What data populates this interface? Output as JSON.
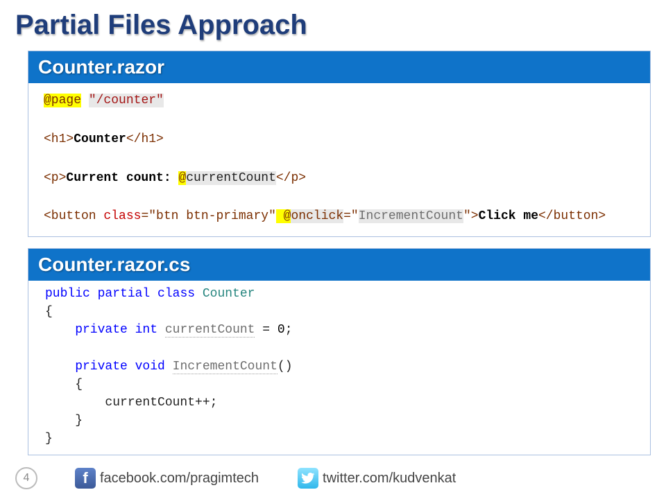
{
  "title": "Partial Files Approach",
  "card1": {
    "header": "Counter.razor",
    "code": {
      "page_directive": "@page",
      "route": "\"/counter\"",
      "h1_open": "<h1>",
      "h1_text": "Counter",
      "h1_close": "</h1>",
      "p_open": "<p>",
      "p_text": "Current count: ",
      "at_var": "@currentCount",
      "p_close": "</p>",
      "btn_open": "<button",
      "btn_class_attr": " class",
      "btn_class_val": "=\"btn btn-primary\"",
      "btn_onclick_at": " @onclick",
      "btn_onclick_val_eq": "=\"",
      "btn_onclick_handler": "IncrementCount",
      "btn_onclick_val_close": "\"",
      "btn_open_end": ">",
      "btn_text": "Click me",
      "btn_close": "</button>"
    }
  },
  "card2": {
    "header": "Counter.razor.cs",
    "code": {
      "l1a": "public",
      "l1b": " partial",
      "l1c": " class",
      "l1d": " Counter",
      "l2": "{",
      "l3a": "    private",
      "l3b": " int",
      "l3c": " ",
      "l3ident": "currentCount",
      "l3d": " = ",
      "l3num": "0",
      "l3e": ";",
      "l5a": "    private",
      "l5b": " void",
      "l5c": " ",
      "l5ident": "IncrementCount",
      "l5d": "()",
      "l6": "    {",
      "l7": "        currentCount++;",
      "l8": "    }",
      "l9": "}"
    }
  },
  "footer": {
    "page_number": "4",
    "facebook": "facebook.com/pragimtech",
    "twitter": "twitter.com/kudvenkat"
  }
}
